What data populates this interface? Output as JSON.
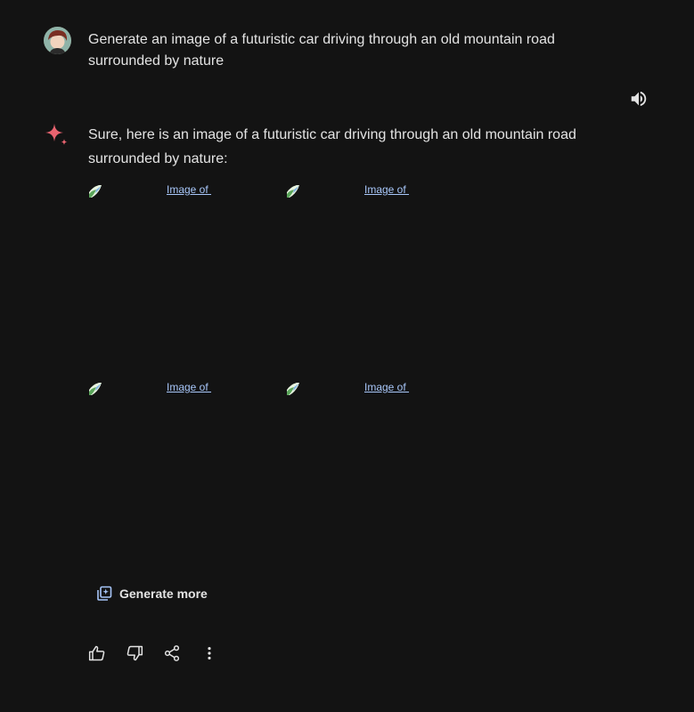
{
  "user_prompt": {
    "text": "Generate an image of a futuristic car driving through an old mountain road surrounded by nature",
    "avatar_icon": "user-avatar"
  },
  "response": {
    "text": "Sure, here is an image of a futuristic car driving through an old mountain road surrounded by nature:",
    "assistant_icon": "gemini-spark-icon",
    "read_aloud_icon": "volume-up-icon"
  },
  "images": [
    {
      "alt": "Image of "
    },
    {
      "alt": "Image of "
    },
    {
      "alt": "Image of "
    },
    {
      "alt": "Image of "
    }
  ],
  "generate_more": {
    "label": "Generate more",
    "icon": "generate-images-icon"
  },
  "actions": [
    {
      "icon": "thumb-up-icon"
    },
    {
      "icon": "thumb-down-icon"
    },
    {
      "icon": "share-icon"
    },
    {
      "icon": "more-vert-icon"
    }
  ],
  "colors": {
    "background": "#131313",
    "text": "#e3e3e3",
    "link": "#a8c7fa",
    "spark_accent": "#e8636f"
  }
}
